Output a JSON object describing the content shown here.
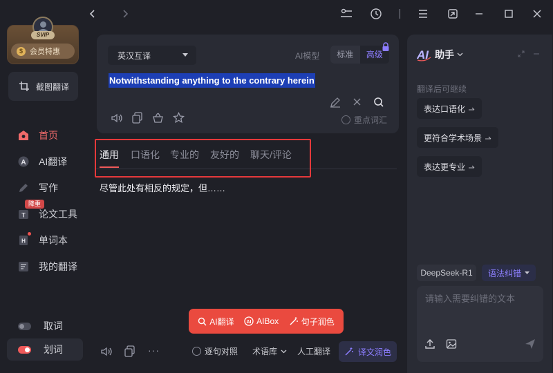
{
  "sidebar": {
    "vip_badge": "SVIP",
    "vip_deal": "会员特惠",
    "screenshot_translate": "截图翻译",
    "nav": [
      {
        "label": "首页",
        "icon": "home-icon",
        "active": true
      },
      {
        "label": "AI翻译",
        "icon": "ai-translate-icon"
      },
      {
        "label": "写作",
        "icon": "write-icon"
      },
      {
        "label": "论文工具",
        "icon": "paper-tool-icon",
        "badge": "降重"
      },
      {
        "label": "单词本",
        "icon": "wordbook-icon",
        "dot": true
      },
      {
        "label": "我的翻译",
        "icon": "my-translation-icon"
      }
    ],
    "toggles": [
      {
        "label": "取词",
        "on": false
      },
      {
        "label": "划词",
        "on": true
      }
    ]
  },
  "input": {
    "language": "英汉互译",
    "ai_model_label": "AI模型",
    "mode_standard": "标准",
    "mode_advanced": "高级",
    "source_text": "Notwithstanding anything to the contrary herein",
    "key_vocab": "重点词汇"
  },
  "tabs": [
    "通用",
    "口语化",
    "专业的",
    "友好的",
    "聊天/评论"
  ],
  "result": {
    "text": "尽管此处有相反的规定，但……"
  },
  "floating_bar": {
    "ai_translate": "AI翻译",
    "aibox": "AIBox",
    "sentence_polish": "句子润色"
  },
  "bottom_toolbar": {
    "sentence_compare": "逐句对照",
    "glossary": "术语库",
    "human_translate": "人工翻译",
    "polish": "译文润色"
  },
  "assistant": {
    "title": "助手",
    "hint": "翻译后可继续",
    "suggestions": [
      "表达口语化",
      "更符合学术场景",
      "表达更专业"
    ],
    "model": "DeepSeek-R1",
    "grammar": "语法纠错",
    "placeholder": "请输入需要纠错的文本"
  },
  "colors": {
    "accent_red": "#ea4a3f",
    "accent_purple": "#8d7dff",
    "selection_blue": "#1d3fb5",
    "background": "#1f2027",
    "panel": "#292b34"
  }
}
